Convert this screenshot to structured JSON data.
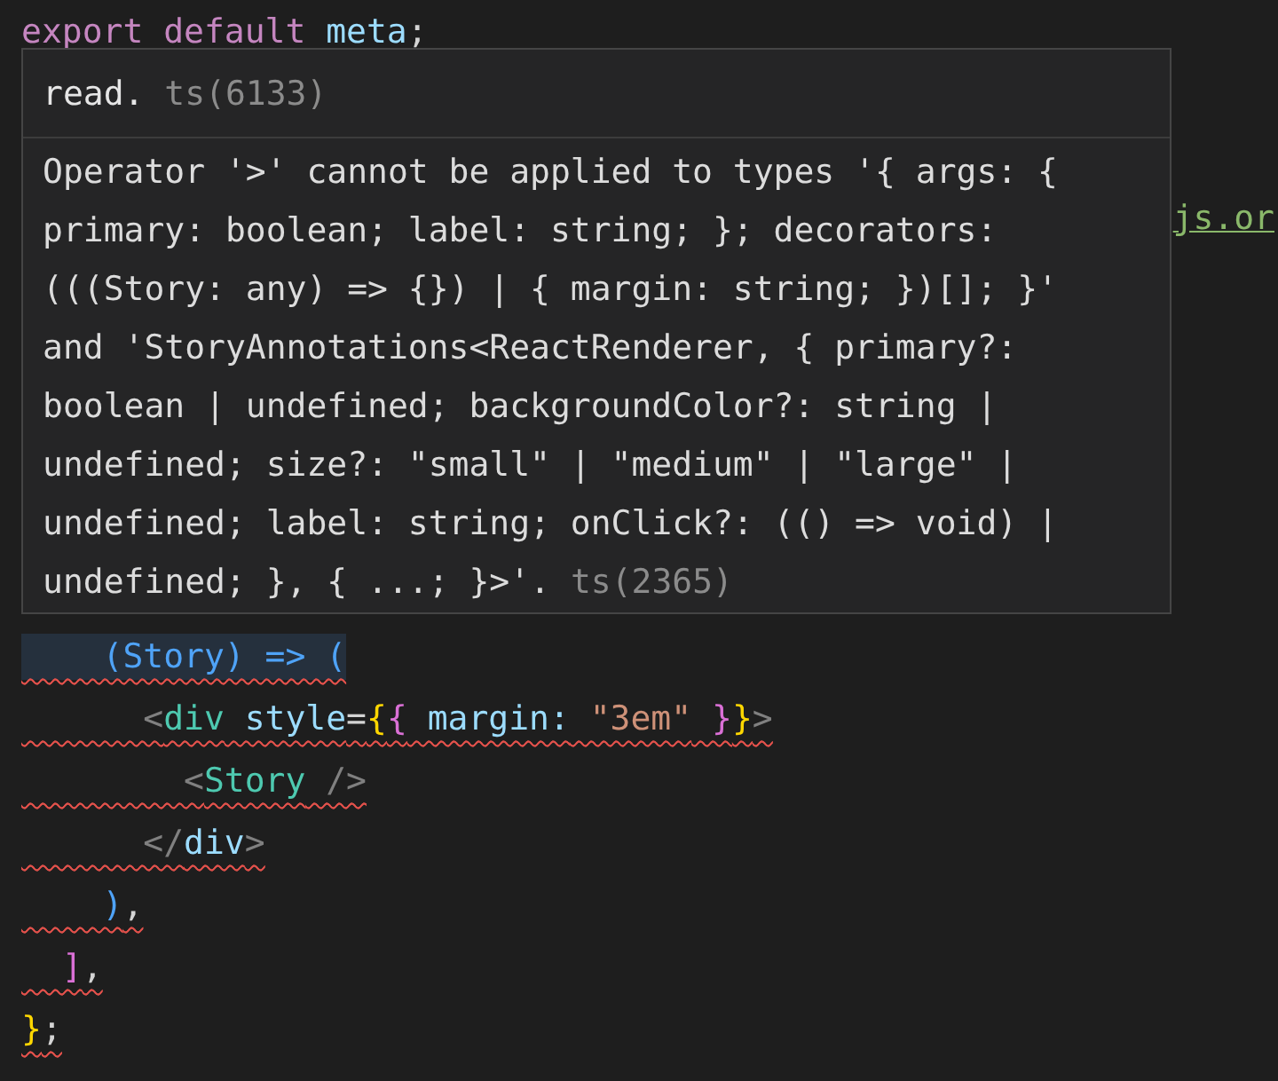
{
  "code_top": [
    {
      "highlighted": false,
      "tokens": [
        {
          "kind": "keyword",
          "text": "export"
        },
        {
          "kind": "keyword",
          "text": " default"
        },
        {
          "kind": "variable",
          "text": " meta"
        },
        {
          "kind": "plain",
          "text": ";"
        }
      ]
    }
  ],
  "code_side": {
    "tokens": [
      {
        "kind": "link",
        "text": "js.or"
      }
    ]
  },
  "code_bottom": [
    {
      "highlighted": true,
      "squiggle": true,
      "tokens": [
        {
          "kind": "bracket3",
          "text": "    (Story) => ("
        }
      ]
    },
    {
      "highlighted": false,
      "squiggle": true,
      "tokens": [
        {
          "kind": "punct",
          "text": "      <"
        },
        {
          "kind": "tag",
          "text": "div"
        },
        {
          "kind": "attr",
          "text": " style"
        },
        {
          "kind": "plain",
          "text": "="
        },
        {
          "kind": "bracket1",
          "text": "{"
        },
        {
          "kind": "bracket2",
          "text": "{"
        },
        {
          "kind": "attr",
          "text": " margin:"
        },
        {
          "kind": "string",
          "text": " \"3em\""
        },
        {
          "kind": "bracket2",
          "text": " }"
        },
        {
          "kind": "bracket1",
          "text": "}"
        },
        {
          "kind": "punct",
          "text": ">"
        }
      ]
    },
    {
      "highlighted": false,
      "squiggle": true,
      "tokens": [
        {
          "kind": "punct",
          "text": "        <"
        },
        {
          "kind": "tag",
          "text": "Story"
        },
        {
          "kind": "punct",
          "text": " />"
        }
      ]
    },
    {
      "highlighted": false,
      "squiggle": true,
      "tokens": [
        {
          "kind": "punct",
          "text": "      </"
        },
        {
          "kind": "attr",
          "text": "div"
        },
        {
          "kind": "punct",
          "text": ">"
        }
      ]
    },
    {
      "highlighted": false,
      "squiggle": true,
      "tokens": [
        {
          "kind": "bracket3",
          "text": "    )"
        },
        {
          "kind": "plain",
          "text": ","
        }
      ]
    },
    {
      "highlighted": false,
      "squiggle": true,
      "tokens": [
        {
          "kind": "bracket2",
          "text": "  ]"
        },
        {
          "kind": "plain",
          "text": ","
        }
      ]
    },
    {
      "highlighted": false,
      "squiggle": true,
      "tokens": [
        {
          "kind": "bracket1",
          "text": "}"
        },
        {
          "kind": "plain",
          "text": ";"
        }
      ]
    }
  ],
  "hover": {
    "header": {
      "message": "read.",
      "code": "ts(6133)"
    },
    "body": {
      "message": "Operator '>' cannot be applied to types '{ args: { primary: boolean; label: string; }; decorators: (((Story: any) => {}) | { margin: string; })[]; }' and 'StoryAnnotations<ReactRenderer, { primary?: boolean | undefined; backgroundColor?: string | undefined; size?: \"small\" | \"medium\" | \"large\" | undefined; label: string; onClick?: (() => void) | undefined; }, { ...; }>'.",
      "code": "ts(2365)"
    }
  }
}
